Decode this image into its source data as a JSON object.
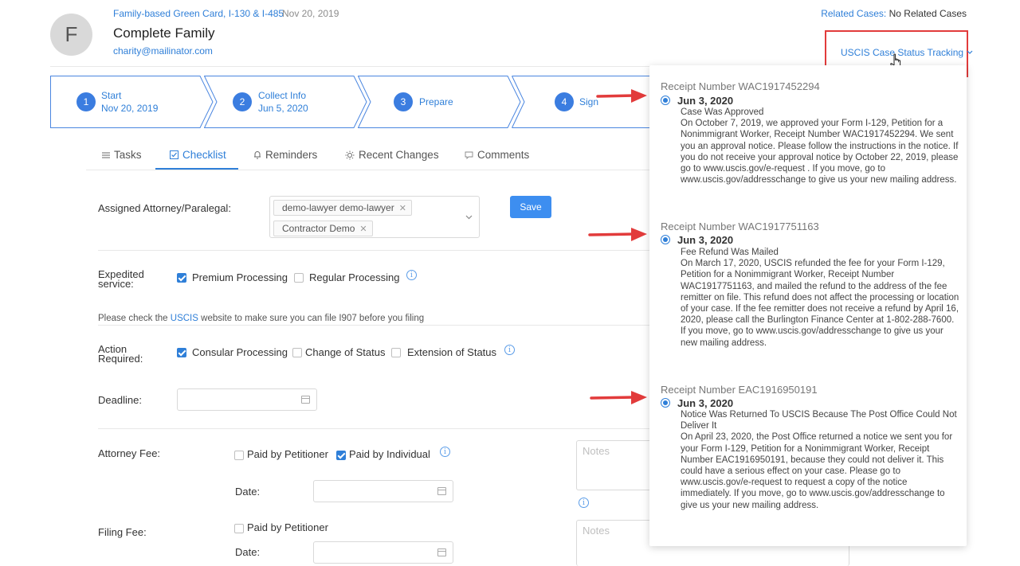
{
  "header": {
    "avatar_letter": "F",
    "case_type": "Family-based Green Card, I-130 & I-485",
    "case_date": "Nov 20, 2019",
    "name": "Complete Family",
    "email": "charity@mailinator.com",
    "related_label": "Related Cases:",
    "related_value": "No Related Cases",
    "tracking_label": "USCIS Case Status Tracking"
  },
  "steps": [
    {
      "num": "1",
      "title": "Start",
      "date": "Nov 20, 2019"
    },
    {
      "num": "2",
      "title": "Collect Info",
      "date": "Jun 5, 2020"
    },
    {
      "num": "3",
      "title": "Prepare"
    },
    {
      "num": "4",
      "title": "Sign"
    }
  ],
  "tabs": [
    {
      "label": "Tasks",
      "icon": "list-icon"
    },
    {
      "label": "Checklist",
      "icon": "checklist-icon",
      "active": true
    },
    {
      "label": "Reminders",
      "icon": "bell-icon"
    },
    {
      "label": "Recent Changes",
      "icon": "bulb-icon"
    },
    {
      "label": "Comments",
      "icon": "comment-icon"
    }
  ],
  "checklist": {
    "assigned_label": "Assigned Attorney/Paralegal:",
    "assignees": [
      "demo-lawyer demo-lawyer",
      "Contractor Demo"
    ],
    "save_label": "Save",
    "expedited_label_1": "Expedited",
    "expedited_label_2": "service:",
    "premium": "Premium Processing",
    "regular": "Regular Processing",
    "note_prefix": "Please check the ",
    "note_link": "USCIS",
    "note_suffix": " website to make sure you can file I907 before you filing",
    "action_label_1": "Action",
    "action_label_2": "Required:",
    "consular": "Consular Processing",
    "change_status": "Change of Status",
    "extension_status": "Extension of Status",
    "deadline_label": "Deadline:",
    "attorney_fee_label": "Attorney Fee:",
    "paid_by_petitioner": "Paid by Petitioner",
    "paid_by_individual": "Paid by Individual",
    "date_label": "Date:",
    "notes_placeholder": "Notes",
    "filing_fee_label": "Filing Fee:"
  },
  "statuses": [
    {
      "receipt": "Receipt Number WAC1917452294",
      "date": "Jun 3, 2020",
      "text": "Case Was Approved\nOn October 7, 2019, we approved your Form I-129, Petition for a Nonimmigrant Worker, Receipt Number WAC1917452294. We sent you an approval notice. Please follow the instructions in the notice. If you do not receive your approval notice by October 22, 2019, please go to www.uscis.gov/e-request . If you move, go to www.uscis.gov/addresschange to give us your new mailing address."
    },
    {
      "receipt": "Receipt Number WAC1917751163",
      "date": "Jun 3, 2020",
      "text": "Fee Refund Was Mailed\nOn March 17, 2020, USCIS refunded the fee for your Form I-129, Petition for a Nonimmigrant Worker, Receipt Number WAC1917751163, and mailed the refund to the address of the fee remitter on file. This refund does not affect the processing or location of your case. If the fee remitter does not receive a refund by April 16, 2020, please call the Burlington Finance Center at 1-802-288-7600. If you move, go to www.uscis.gov/addresschange to give us your new mailing address."
    },
    {
      "receipt": "Receipt Number EAC1916950191",
      "date": "Jun 3, 2020",
      "text": "Notice Was Returned To USCIS Because The Post Office Could Not Deliver It\nOn April 23, 2020, the Post Office returned a notice we sent you for your Form I-129, Petition for a Nonimmigrant Worker, Receipt Number EAC1916950191, because they could not deliver it. This could have a serious effect on your case. Please go to www.uscis.gov/e-request to request a copy of the notice immediately. If you move, go to www.uscis.gov/addresschange to give us your new mailing address."
    }
  ],
  "colors": {
    "accent": "#2f7fd8",
    "highlight": "#e23b3b"
  }
}
